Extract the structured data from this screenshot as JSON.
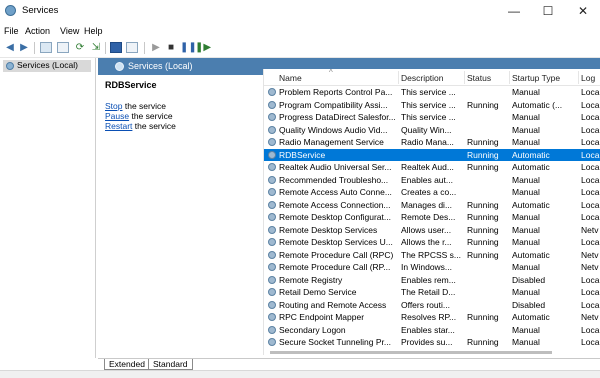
{
  "window": {
    "title": "Services",
    "minimize": "—",
    "maximize": "☐",
    "close": "✕"
  },
  "menu": [
    "File",
    "Action",
    "View",
    "Help"
  ],
  "tree": {
    "label": "Services (Local)"
  },
  "pane": {
    "header": "Services (Local)",
    "selected_service": "RDBService",
    "actions": [
      {
        "link": "Stop",
        "rest": " the service"
      },
      {
        "link": "Pause",
        "rest": " the service"
      },
      {
        "link": "Restart",
        "rest": " the service"
      }
    ]
  },
  "columns": {
    "name": "Name",
    "description": "Description",
    "status": "Status",
    "startup": "Startup Type",
    "log": "Log"
  },
  "services": [
    {
      "name": "Problem Reports Control Pa...",
      "description": "This service ...",
      "status": "",
      "startup": "Manual",
      "log": "Loca"
    },
    {
      "name": "Program Compatibility Assi...",
      "description": "This service ...",
      "status": "Running",
      "startup": "Automatic (...",
      "log": "Loca"
    },
    {
      "name": "Progress DataDirect Salesfor...",
      "description": "This service ...",
      "status": "",
      "startup": "Manual",
      "log": "Loca"
    },
    {
      "name": "Quality Windows Audio Vid...",
      "description": "Quality Win...",
      "status": "",
      "startup": "Manual",
      "log": "Loca"
    },
    {
      "name": "Radio Management Service",
      "description": "Radio Mana...",
      "status": "Running",
      "startup": "Manual",
      "log": "Loca"
    },
    {
      "name": "RDBService",
      "description": "",
      "status": "Running",
      "startup": "Automatic",
      "log": "Loca",
      "selected": true
    },
    {
      "name": "Realtek Audio Universal Ser...",
      "description": "Realtek Aud...",
      "status": "Running",
      "startup": "Automatic",
      "log": "Loca"
    },
    {
      "name": "Recommended Troublesho...",
      "description": "Enables aut...",
      "status": "",
      "startup": "Manual",
      "log": "Loca"
    },
    {
      "name": "Remote Access Auto Conne...",
      "description": "Creates a co...",
      "status": "",
      "startup": "Manual",
      "log": "Loca"
    },
    {
      "name": "Remote Access Connection...",
      "description": "Manages di...",
      "status": "Running",
      "startup": "Automatic",
      "log": "Loca"
    },
    {
      "name": "Remote Desktop Configurat...",
      "description": "Remote Des...",
      "status": "Running",
      "startup": "Manual",
      "log": "Loca"
    },
    {
      "name": "Remote Desktop Services",
      "description": "Allows user...",
      "status": "Running",
      "startup": "Manual",
      "log": "Netv"
    },
    {
      "name": "Remote Desktop Services U...",
      "description": "Allows the r...",
      "status": "Running",
      "startup": "Manual",
      "log": "Loca"
    },
    {
      "name": "Remote Procedure Call (RPC)",
      "description": "The RPCSS s...",
      "status": "Running",
      "startup": "Automatic",
      "log": "Netv"
    },
    {
      "name": "Remote Procedure Call (RP...",
      "description": "In Windows...",
      "status": "",
      "startup": "Manual",
      "log": "Netv"
    },
    {
      "name": "Remote Registry",
      "description": "Enables rem...",
      "status": "",
      "startup": "Disabled",
      "log": "Loca"
    },
    {
      "name": "Retail Demo Service",
      "description": "The Retail D...",
      "status": "",
      "startup": "Manual",
      "log": "Loca"
    },
    {
      "name": "Routing and Remote Access",
      "description": "Offers routi...",
      "status": "",
      "startup": "Disabled",
      "log": "Loca"
    },
    {
      "name": "RPC Endpoint Mapper",
      "description": "Resolves RP...",
      "status": "Running",
      "startup": "Automatic",
      "log": "Netv"
    },
    {
      "name": "Secondary Logon",
      "description": "Enables star...",
      "status": "",
      "startup": "Manual",
      "log": "Loca"
    },
    {
      "name": "Secure Socket Tunneling Pr...",
      "description": "Provides su...",
      "status": "Running",
      "startup": "Manual",
      "log": "Loca"
    }
  ],
  "tabs": [
    "Extended",
    "Standard"
  ],
  "colors": {
    "header": "#4b7eaf",
    "selection": "#0078d7",
    "link": "#0a4fb4"
  }
}
